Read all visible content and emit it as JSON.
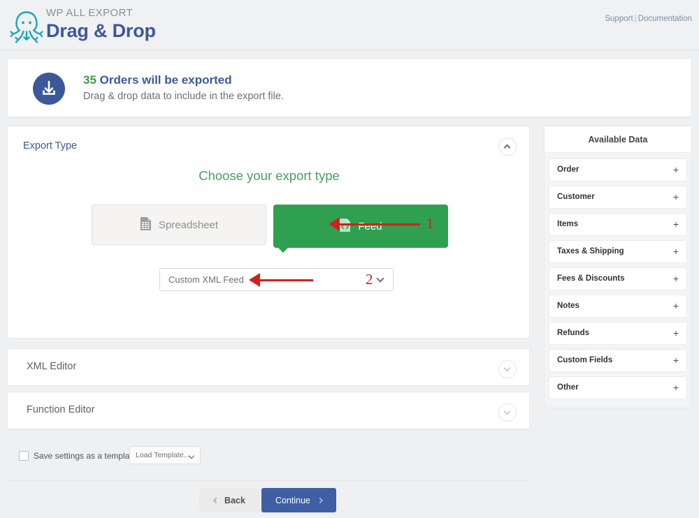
{
  "header": {
    "brand_top": "WP ALL EXPORT",
    "brand_main": "Drag & Drop",
    "logo_icon": "octopus-logo-icon",
    "support_link": "Support",
    "separator": "|",
    "documentation_link": "Documentation"
  },
  "summary": {
    "icon": "download-icon",
    "count": "35",
    "title_rest": " Orders will be exported",
    "subtitle": "Drag & drop data to include in the export file."
  },
  "export_type": {
    "section_title": "Export Type",
    "collapse_icon": "chevron-up-icon",
    "heading": "Choose your export type",
    "spreadsheet": {
      "label": "Spreadsheet",
      "icon": "spreadsheet-icon"
    },
    "feed": {
      "label": "Feed",
      "icon": "code-file-icon"
    },
    "feed_select": {
      "value": "Custom XML Feed",
      "icon": "chevron-down-icon"
    }
  },
  "annotations": [
    {
      "number": "1",
      "icon": "arrow-left-icon"
    },
    {
      "number": "2",
      "icon": "arrow-left-icon"
    }
  ],
  "sections": [
    {
      "title": "XML Editor",
      "collapse_icon": "chevron-down-icon"
    },
    {
      "title": "Function Editor",
      "collapse_icon": "chevron-down-icon"
    }
  ],
  "template_row": {
    "checkbox_label": "Save settings as a template",
    "checkbox_checked": false,
    "load_template_value": "Load Template...",
    "load_template_icon": "chevron-down-icon"
  },
  "footer": {
    "back_label": "Back",
    "back_icon": "chevron-left-icon",
    "continue_label": "Continue",
    "continue_icon": "chevron-right-icon"
  },
  "sidebar": {
    "header": "Available Data",
    "items": [
      {
        "label": "Order",
        "expand_icon": "plus-icon"
      },
      {
        "label": "Customer",
        "expand_icon": "plus-icon"
      },
      {
        "label": "Items",
        "expand_icon": "plus-icon"
      },
      {
        "label": "Taxes & Shipping",
        "expand_icon": "plus-icon"
      },
      {
        "label": "Fees & Discounts",
        "expand_icon": "plus-icon"
      },
      {
        "label": "Notes",
        "expand_icon": "plus-icon"
      },
      {
        "label": "Refunds",
        "expand_icon": "plus-icon"
      },
      {
        "label": "Custom Fields",
        "expand_icon": "plus-icon"
      },
      {
        "label": "Other",
        "expand_icon": "plus-icon"
      }
    ]
  },
  "colors": {
    "brand_blue": "#3e589b",
    "green_accent": "#2fa04f",
    "heading_green": "#4a9e62",
    "count_green": "#3c9c48",
    "annotation_red": "#d41f1f",
    "page_bg": "#eef0f2",
    "logo_teal": "#1ba7b4"
  }
}
